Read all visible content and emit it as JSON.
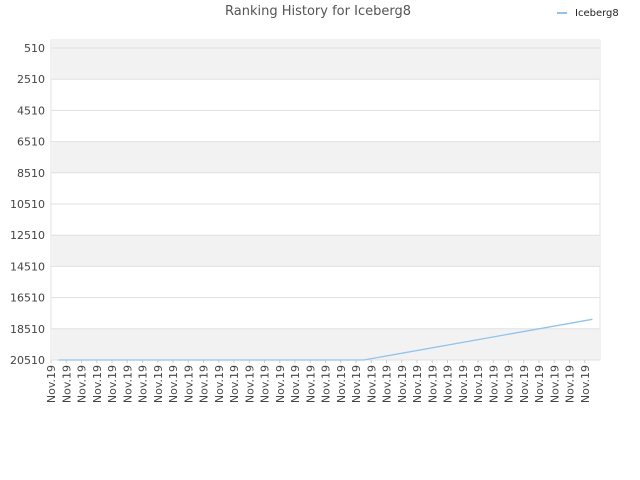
{
  "chart_data": {
    "type": "line",
    "title": "Ranking History for Iceberg8",
    "xlabel": "",
    "ylabel": "",
    "y_inverted": true,
    "ylim": [
      510,
      20510
    ],
    "yticks": [
      510,
      2510,
      4510,
      6510,
      8510,
      10510,
      12510,
      14510,
      16510,
      18510,
      20510
    ],
    "grid": true,
    "legend_position": "top-right",
    "categories": [
      "Nov.19",
      "Nov.19",
      "Nov.19",
      "Nov.19",
      "Nov.19",
      "Nov.19",
      "Nov.19",
      "Nov.19",
      "Nov.19",
      "Nov.19",
      "Nov.19",
      "Nov.19",
      "Nov.19",
      "Nov.19",
      "Nov.19",
      "Nov.19",
      "Nov.19",
      "Nov.19",
      "Nov.19",
      "Nov.19",
      "Nov.19",
      "Nov.19",
      "Nov.19",
      "Nov.19",
      "Nov.19",
      "Nov.19",
      "Nov.19",
      "Nov.19",
      "Nov.19",
      "Nov.19",
      "Nov.19",
      "Nov.19",
      "Nov.19",
      "Nov.19",
      "Nov.19",
      "Nov.19"
    ],
    "series": [
      {
        "name": "Iceberg8",
        "color": "#90c3ee",
        "x_index": [
          0.5,
          20.5,
          35.5
        ],
        "values": [
          20510,
          20510,
          17900
        ]
      }
    ]
  }
}
